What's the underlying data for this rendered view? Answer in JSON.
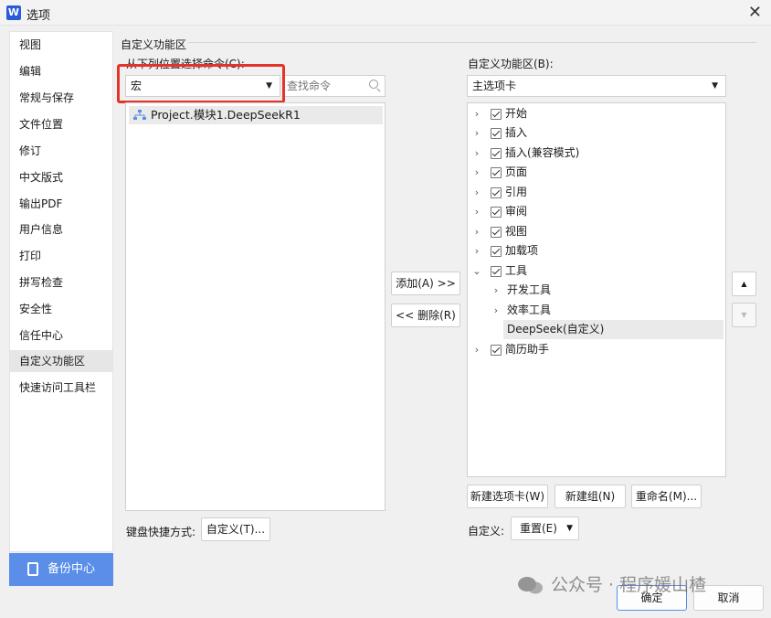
{
  "window": {
    "app_icon": "W",
    "title": "选项",
    "close_glyph": "✕"
  },
  "sidebar": {
    "items": [
      {
        "label": "视图"
      },
      {
        "label": "编辑"
      },
      {
        "label": "常规与保存"
      },
      {
        "label": "文件位置"
      },
      {
        "label": "修订"
      },
      {
        "label": "中文版式"
      },
      {
        "label": "输出PDF"
      },
      {
        "label": "用户信息"
      },
      {
        "label": "打印"
      },
      {
        "label": "拼写检查"
      },
      {
        "label": "安全性"
      },
      {
        "label": "信任中心"
      },
      {
        "label": "自定义功能区",
        "active": true
      },
      {
        "label": "快速访问工具栏"
      }
    ],
    "backup_label": "备份中心"
  },
  "main": {
    "section_title": "自定义功能区",
    "left": {
      "choose_label": "从下列位置选择命令(C):",
      "combo_value": "宏",
      "search_placeholder": "查找命令",
      "items": [
        "Project.模块1.DeepSeekR1"
      ]
    },
    "middle": {
      "add_label": "添加(A) >>",
      "remove_label": "<< 删除(R)"
    },
    "right": {
      "label": "自定义功能区(B):",
      "combo_value": "主选项卡",
      "tree": [
        {
          "label": "开始",
          "expanded": false,
          "checked": true
        },
        {
          "label": "插入",
          "expanded": false,
          "checked": true
        },
        {
          "label": "插入(兼容模式)",
          "expanded": false,
          "checked": true
        },
        {
          "label": "页面",
          "expanded": false,
          "checked": true
        },
        {
          "label": "引用",
          "expanded": false,
          "checked": true
        },
        {
          "label": "审阅",
          "expanded": false,
          "checked": true
        },
        {
          "label": "视图",
          "expanded": false,
          "checked": true
        },
        {
          "label": "加载项",
          "expanded": false,
          "checked": true
        },
        {
          "label": "工具",
          "expanded": true,
          "checked": true
        },
        {
          "label": "开发工具",
          "level": 2
        },
        {
          "label": "效率工具",
          "level": 2
        },
        {
          "label": "DeepSeek(自定义)",
          "level": 2,
          "selected": true
        },
        {
          "label": "简历助手",
          "expanded": false,
          "checked": true
        }
      ],
      "new_tab_label": "新建选项卡(W)",
      "new_group_label": "新建组(N)",
      "rename_label": "重命名(M)...",
      "customize_label": "自定义:",
      "reset_label": "重置(E)"
    },
    "keyboard_label": "键盘快捷方式:",
    "keyboard_button": "自定义(T)..."
  },
  "footer": {
    "ok_label": "确定",
    "cancel_label": "取消"
  },
  "watermark": {
    "text": "公众号 · 程序媛山楂"
  },
  "colors": {
    "accent": "#5a8ee8",
    "highlight": "#e53329",
    "selected_row": "#eaeaea"
  }
}
